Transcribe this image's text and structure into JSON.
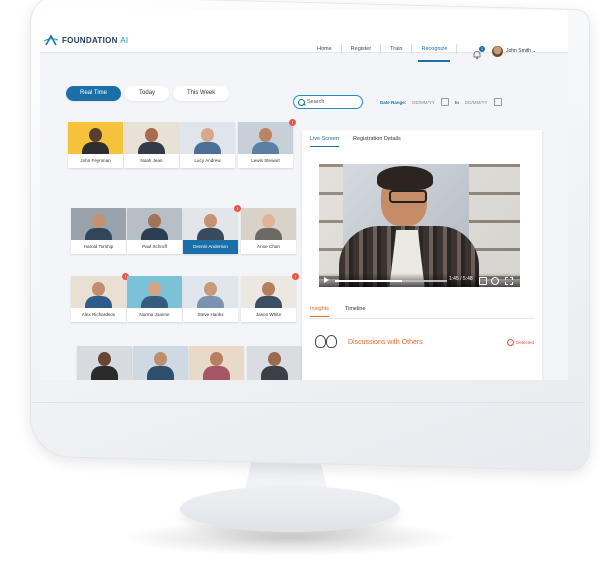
{
  "brand": {
    "name": "FOUNDATION",
    "suffix": "AI"
  },
  "nav": {
    "items": [
      {
        "label": "Home",
        "active": false
      },
      {
        "label": "Register",
        "active": false
      },
      {
        "label": "Train",
        "active": false
      },
      {
        "label": "Recognize",
        "active": true
      }
    ],
    "notification_count": "1",
    "user_name": "John Smith"
  },
  "filters": {
    "tabs": [
      {
        "label": "Real Time",
        "active": true
      },
      {
        "label": "Today",
        "active": false
      },
      {
        "label": "This Week",
        "active": false
      }
    ],
    "search_label": "Search",
    "date_range_label": "Date Range:",
    "date_from": "DD/MM/YY",
    "to_label": "to",
    "date_to": "DD/MM/YY"
  },
  "people": [
    {
      "name": "John Feynman",
      "badge": ""
    },
    {
      "name": "Noah Jean",
      "badge": ""
    },
    {
      "name": "Lucy Andrew",
      "badge": ""
    },
    {
      "name": "Lewis Stewart",
      "badge": "!"
    },
    {
      "name": "Harold Torship",
      "badge": ""
    },
    {
      "name": "Paul Schroff",
      "badge": ""
    },
    {
      "name": "Dennis Anderson",
      "badge": "!",
      "selected": true
    },
    {
      "name": "Anne Chan",
      "badge": ""
    },
    {
      "name": "Alex Richardson",
      "badge": "!"
    },
    {
      "name": "Norma Joanne",
      "badge": ""
    },
    {
      "name": "Steve Hanks",
      "badge": ""
    },
    {
      "name": "Jason White",
      "badge": "!"
    },
    {
      "name": "",
      "badge": ""
    },
    {
      "name": "",
      "badge": ""
    },
    {
      "name": "",
      "badge": ""
    },
    {
      "name": "",
      "badge": ""
    }
  ],
  "panel": {
    "tabs": [
      {
        "label": "Live Screen",
        "active": true
      },
      {
        "label": "Registration Details",
        "active": false
      }
    ],
    "video_time": "1:45 / 5:48",
    "progress_fraction": 0.6,
    "sub_tabs": [
      {
        "label": "Insights",
        "active": true
      },
      {
        "label": "Timeline",
        "active": false
      }
    ],
    "insight_title": "Discussions with Others",
    "insight_status": "Detected"
  },
  "colors": {
    "accent": "#1a6fa8",
    "alert": "#e8574e",
    "insight": "#e66a2c"
  }
}
